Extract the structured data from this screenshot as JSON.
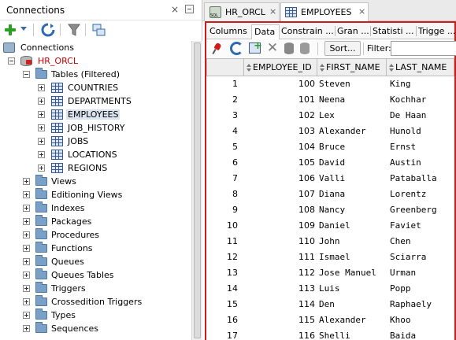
{
  "connections_panel": {
    "title": "Connections",
    "close_glyph": "×",
    "toolbar_icons": [
      "add-connection-icon",
      "dropdown-caret-icon",
      "refresh-icon",
      "filter-icon",
      "schema-browser-icon"
    ]
  },
  "tree": {
    "root_label": "Connections",
    "connection_label": "HR_ORCL",
    "tables_label": "Tables (Filtered)",
    "tables": [
      "COUNTRIES",
      "DEPARTMENTS",
      "EMPLOYEES",
      "JOB_HISTORY",
      "JOBS",
      "LOCATIONS",
      "REGIONS"
    ],
    "selected_table": "EMPLOYEES",
    "nodes": [
      "Views",
      "Editioning Views",
      "Indexes",
      "Packages",
      "Procedures",
      "Functions",
      "Queues",
      "Queues Tables",
      "Triggers",
      "Crossedition Triggers",
      "Types",
      "Sequences"
    ]
  },
  "editor_tabs": [
    {
      "label": "HR_ORCL",
      "icon": "sql-worksheet-icon",
      "active": false
    },
    {
      "label": "EMPLOYEES",
      "icon": "table-icon",
      "active": true
    }
  ],
  "tab_close_glyph": "×",
  "sub_tabs": [
    "Columns",
    "Data",
    "Constrain ...",
    "Gran ...",
    "Statisti ...",
    "Trigge ..."
  ],
  "active_sub_tab": "Data",
  "data_toolbar": {
    "sort_label": "Sort...",
    "filter_label": "Filter:",
    "filter_value": ""
  },
  "grid": {
    "columns": [
      "EMPLOYEE_ID",
      "FIRST_NAME",
      "LAST_NAME"
    ],
    "rows": [
      {
        "n": "1",
        "id": "100",
        "first": "Steven",
        "last": "King"
      },
      {
        "n": "2",
        "id": "101",
        "first": "Neena",
        "last": "Kochhar"
      },
      {
        "n": "3",
        "id": "102",
        "first": "Lex",
        "last": "De Haan"
      },
      {
        "n": "4",
        "id": "103",
        "first": "Alexander",
        "last": "Hunold"
      },
      {
        "n": "5",
        "id": "104",
        "first": "Bruce",
        "last": "Ernst"
      },
      {
        "n": "6",
        "id": "105",
        "first": "David",
        "last": "Austin"
      },
      {
        "n": "7",
        "id": "106",
        "first": "Valli",
        "last": "Pataballa"
      },
      {
        "n": "8",
        "id": "107",
        "first": "Diana",
        "last": "Lorentz"
      },
      {
        "n": "9",
        "id": "108",
        "first": "Nancy",
        "last": "Greenberg"
      },
      {
        "n": "10",
        "id": "109",
        "first": "Daniel",
        "last": "Faviet"
      },
      {
        "n": "11",
        "id": "110",
        "first": "John",
        "last": "Chen"
      },
      {
        "n": "12",
        "id": "111",
        "first": "Ismael",
        "last": "Sciarra"
      },
      {
        "n": "13",
        "id": "112",
        "first": "Jose Manuel",
        "last": "Urman"
      },
      {
        "n": "14",
        "id": "113",
        "first": "Luis",
        "last": "Popp"
      },
      {
        "n": "15",
        "id": "114",
        "first": "Den",
        "last": "Raphaely"
      },
      {
        "n": "16",
        "id": "115",
        "first": "Alexander",
        "last": "Khoo"
      },
      {
        "n": "17",
        "id": "116",
        "first": "Shelli",
        "last": "Baida"
      }
    ]
  },
  "colors": {
    "connection_name": "#cc0000",
    "active_editor_border": "#d11a1a",
    "add_icon": "#29a01f"
  }
}
